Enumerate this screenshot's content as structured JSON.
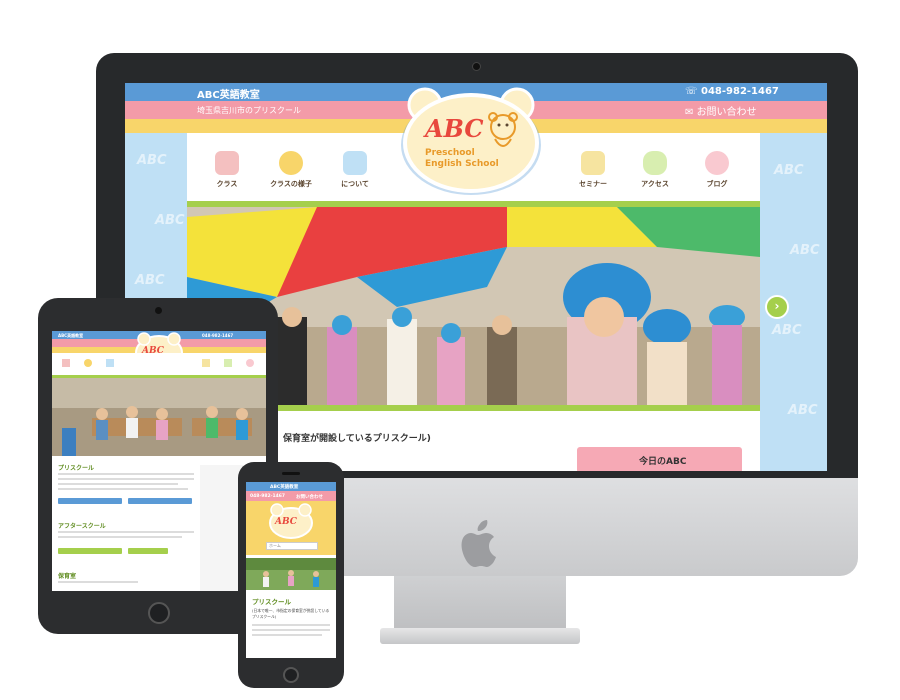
{
  "site": {
    "name": "ABC英語教室",
    "tagline": "埼玉県吉川市のプリスクール",
    "phone": "048-982-1467",
    "contact_label": "お問い合わせ",
    "logo_text": "ABC",
    "logo_subtitle_1": "Preschool",
    "logo_subtitle_2": "English School",
    "side_pattern": "ABC",
    "nav_items": [
      {
        "label": "クラス",
        "icon": "crayons-icon"
      },
      {
        "label": "クラスの様子",
        "icon": "clock-icon"
      },
      {
        "label": "について",
        "icon": "abc-blocks-icon"
      },
      {
        "label": "セミナー",
        "icon": "calendar-icon"
      },
      {
        "label": "アクセス",
        "icon": "car-icon"
      },
      {
        "label": "ブログ",
        "icon": "girl-icon"
      }
    ],
    "content_snippet": "保育室が開設しているプリスクール)",
    "today_label": "今日のABC",
    "colors": {
      "blue": "#5a9ad6",
      "pink": "#f39ba8",
      "yellow": "#f8d56a",
      "green": "#a5cf4c"
    }
  },
  "tablet": {
    "title": "ABC英語教室",
    "section_1": "プリスクール",
    "section_2": "アフタースクール",
    "section_3": "保育室"
  },
  "phone": {
    "title": "ABC英語教室",
    "phone_number": "048-982-1467",
    "contact_label": "お問い合わせ",
    "search_placeholder": "ホーム",
    "section_title": "プリスクール",
    "text_1": "(日本で唯一、市指定の保育室が併設している",
    "text_2": "プリスクール)"
  }
}
